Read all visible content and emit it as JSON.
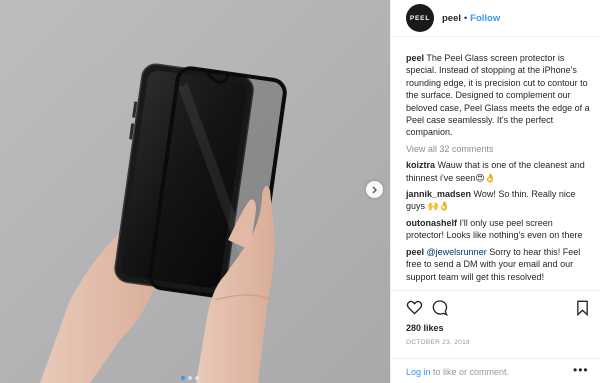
{
  "post": {
    "author": "peel",
    "avatar_text": "PEEL",
    "separator": "•",
    "follow_label": "Follow",
    "caption_user": "peel",
    "caption_text": "The Peel Glass screen protector is special. Instead of stopping at the iPhone's rounding edge, it is precision cut to contour to the surface. Designed to complement our beloved case, Peel Glass meets the edge of a Peel case seamlessly. It's the perfect companion.",
    "view_all_comments": "View all 32 comments",
    "comments": [
      {
        "user": "koiztra",
        "text": "Wauw that is one of the cleanest and thinnest i've seen😍👌"
      },
      {
        "user": "jannik_madsen",
        "text": "Wow! So thin. Really nice guys 🙌👌"
      },
      {
        "user": "outonashelf",
        "text": "I'll only use peel screen protector! Looks like nothing's even on there"
      },
      {
        "user": "peel",
        "mention": "@jewelsrunner",
        "text": " Sorry to hear this! Feel free to send a DM with your email and our support team will get this resolved!"
      }
    ],
    "likes": "280 likes",
    "date": "OCTOBER 23, 2018",
    "login_link": "Log in",
    "login_text": " to like or comment.",
    "more": "•••",
    "carousel": {
      "slides": 3,
      "active_index": 0
    }
  }
}
